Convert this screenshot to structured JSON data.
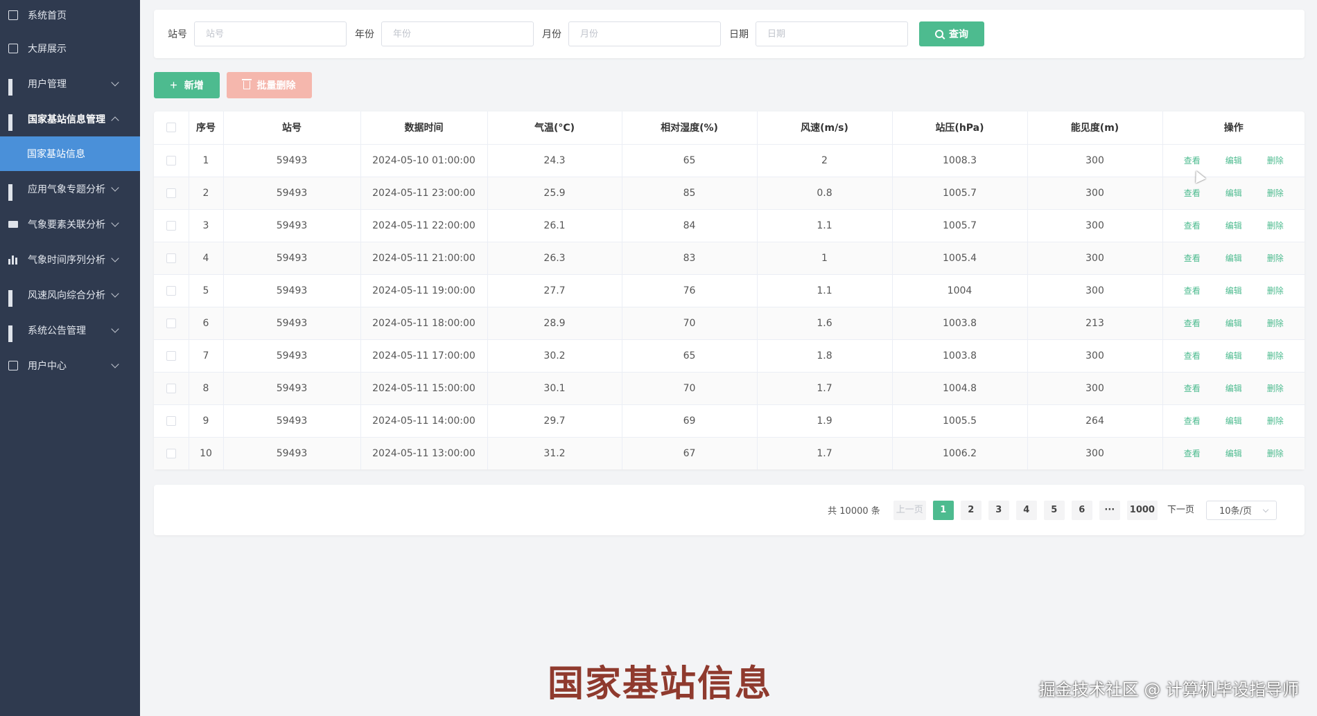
{
  "sidebar": {
    "items": [
      {
        "label": "系统首页",
        "icon": "home-icon"
      },
      {
        "label": "大屏展示",
        "icon": "screen-icon"
      },
      {
        "label": "用户管理",
        "icon": "grid-icon"
      },
      {
        "label": "国家基站信息管理",
        "icon": "grid-icon"
      },
      {
        "label": "国家基站信息"
      },
      {
        "label": "应用气象专题分析",
        "icon": "grid-icon"
      },
      {
        "label": "气象要素关联分析",
        "icon": "chart-icon"
      },
      {
        "label": "气象时间序列分析",
        "icon": "bar-chart-icon"
      },
      {
        "label": "风速风向综合分析",
        "icon": "grid-icon"
      },
      {
        "label": "系统公告管理",
        "icon": "grid-icon"
      },
      {
        "label": "用户中心",
        "icon": "user-icon"
      }
    ]
  },
  "search": {
    "station_label": "站号",
    "station_placeholder": "站号",
    "year_label": "年份",
    "year_placeholder": "年份",
    "month_label": "月份",
    "month_placeholder": "月份",
    "date_label": "日期",
    "date_placeholder": "日期",
    "query_label": "查询"
  },
  "actions": {
    "add_label": "新增",
    "batch_delete_label": "批量删除"
  },
  "table": {
    "headers": [
      "序号",
      "站号",
      "数据时间",
      "气温(°C)",
      "相对湿度(%)",
      "风速(m/s)",
      "站压(hPa)",
      "能见度(m)",
      "操作"
    ],
    "op_view": "查看",
    "op_edit": "编辑",
    "op_delete": "删除",
    "rows": [
      [
        "1",
        "59493",
        "2024-05-10 01:00:00",
        "24.3",
        "65",
        "2",
        "1008.3",
        "300"
      ],
      [
        "2",
        "59493",
        "2024-05-11 23:00:00",
        "25.9",
        "85",
        "0.8",
        "1005.7",
        "300"
      ],
      [
        "3",
        "59493",
        "2024-05-11 22:00:00",
        "26.1",
        "84",
        "1.1",
        "1005.7",
        "300"
      ],
      [
        "4",
        "59493",
        "2024-05-11 21:00:00",
        "26.3",
        "83",
        "1",
        "1005.4",
        "300"
      ],
      [
        "5",
        "59493",
        "2024-05-11 19:00:00",
        "27.7",
        "76",
        "1.1",
        "1004",
        "300"
      ],
      [
        "6",
        "59493",
        "2024-05-11 18:00:00",
        "28.9",
        "70",
        "1.6",
        "1003.8",
        "213"
      ],
      [
        "7",
        "59493",
        "2024-05-11 17:00:00",
        "30.2",
        "65",
        "1.8",
        "1003.8",
        "300"
      ],
      [
        "8",
        "59493",
        "2024-05-11 15:00:00",
        "30.1",
        "70",
        "1.7",
        "1004.8",
        "300"
      ],
      [
        "9",
        "59493",
        "2024-05-11 14:00:00",
        "29.7",
        "69",
        "1.9",
        "1005.5",
        "264"
      ],
      [
        "10",
        "59493",
        "2024-05-11 13:00:00",
        "31.2",
        "67",
        "1.7",
        "1006.2",
        "300"
      ]
    ]
  },
  "pagination": {
    "total": "共 10000 条",
    "prev": "上一页",
    "pages": [
      "1",
      "2",
      "3",
      "4",
      "5",
      "6",
      "···",
      "1000"
    ],
    "current": "1",
    "next": "下一页",
    "page_size": "10条/页"
  },
  "caption": "国家基站信息",
  "watermark": "掘金技术社区 @ 计算机毕设指导师",
  "colors": {
    "sidebar_bg": "#2f3a4f",
    "sidebar_active": "#4a90d9",
    "accent": "#4dbb8f",
    "danger_light": "#f5b7ad"
  }
}
